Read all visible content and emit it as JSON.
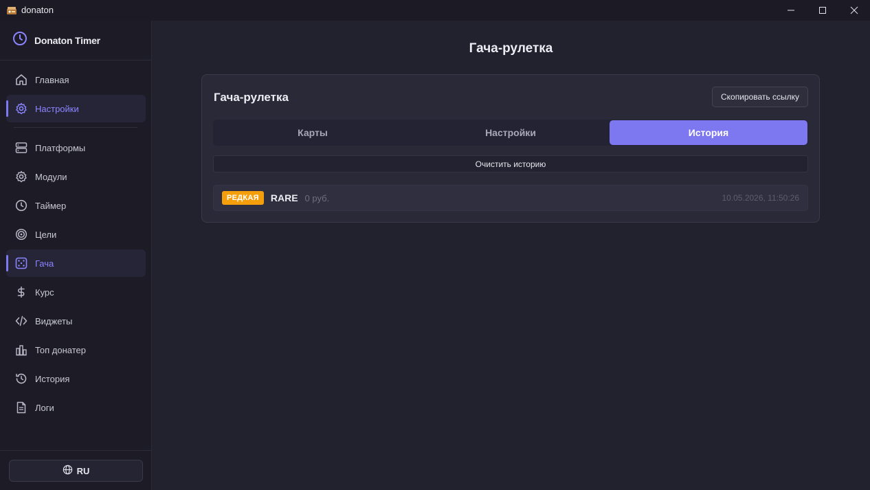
{
  "window": {
    "title": "donaton"
  },
  "brand": {
    "name": "Donaton Timer"
  },
  "sidebar": {
    "items": [
      {
        "label": "Главная",
        "icon": "home-icon"
      },
      {
        "label": "Настройки",
        "icon": "gear-icon",
        "active": true
      },
      {
        "label": "Платформы",
        "icon": "server-icon"
      },
      {
        "label": "Модули",
        "icon": "gear-icon"
      },
      {
        "label": "Таймер",
        "icon": "clock-icon"
      },
      {
        "label": "Цели",
        "icon": "target-icon"
      },
      {
        "label": "Гача",
        "icon": "dice-icon",
        "active": true
      },
      {
        "label": "Курс",
        "icon": "dollar-icon"
      },
      {
        "label": "Виджеты",
        "icon": "code-icon"
      },
      {
        "label": "Топ донатер",
        "icon": "podium-icon"
      },
      {
        "label": "История",
        "icon": "history-icon"
      },
      {
        "label": "Логи",
        "icon": "file-icon"
      }
    ],
    "language": "RU"
  },
  "page": {
    "title": "Гача-рулетка"
  },
  "card": {
    "title": "Гача-рулетка",
    "copy_label": "Скопировать ссылку",
    "tabs": [
      {
        "label": "Карты"
      },
      {
        "label": "Настройки"
      },
      {
        "label": "История",
        "active": true
      }
    ],
    "clear_label": "Очистить историю",
    "history": [
      {
        "rarity": "РЕДКАЯ",
        "name": "RARE",
        "amount": "0 руб.",
        "time": "10.05.2026, 11:50:26"
      }
    ]
  },
  "colors": {
    "accent": "#7d77f0",
    "badge_rare": "#f59e0b",
    "background": "#22212e",
    "sidebar": "#1c1b26"
  }
}
